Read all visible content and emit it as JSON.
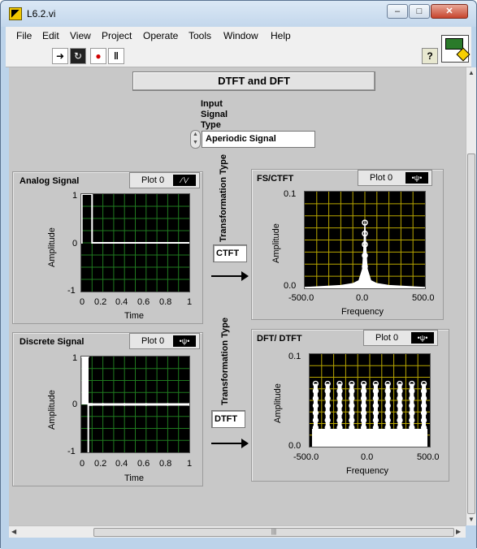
{
  "window": {
    "title": "L6.2.vi",
    "controls": {
      "minimize": "–",
      "maximize": "□",
      "close": "✕"
    }
  },
  "menu": [
    "File",
    "Edit",
    "View",
    "Project",
    "Operate",
    "Tools",
    "Window",
    "Help"
  ],
  "toolbar": {
    "icons": [
      "run-arrow-icon",
      "run-continuously-icon",
      "abort-icon",
      "pause-icon"
    ],
    "run": "➜",
    "run_continuous": "↻",
    "abort": "●",
    "pause": "‖",
    "help": "?"
  },
  "panel": {
    "title": "DTFT and DFT",
    "selector": {
      "label": "Input Signal Type",
      "value": "Aperiodic Signal"
    },
    "legend_label": "Plot 0",
    "transformation_label": "Transformation Type",
    "analog": {
      "title": "Analog Signal",
      "ylabel": "Amplitude",
      "xlabel": "Time",
      "yticks": [
        "1",
        "0",
        "-1"
      ],
      "xticks": [
        "0",
        "0.2",
        "0.4",
        "0.6",
        "0.8",
        "1"
      ]
    },
    "discrete": {
      "title": "Discrete Signal",
      "ylabel": "Amplitude",
      "xlabel": "Time",
      "yticks": [
        "1",
        "0",
        "-1"
      ],
      "xticks": [
        "0",
        "0.2",
        "0.4",
        "0.6",
        "0.8",
        "1"
      ]
    },
    "fs_ctft": {
      "title": "FS/CTFT",
      "ylabel": "Amplitude",
      "xlabel": "Frequency",
      "yticks": [
        "0.1",
        "0.0"
      ],
      "xticks": [
        "-500.0",
        "0.0",
        "500.0"
      ],
      "transform": "CTFT"
    },
    "dft": {
      "title": "DFT/ DTFT",
      "ylabel": "Amplitude",
      "xlabel": "Frequency",
      "yticks": [
        "0.1",
        "0.0"
      ],
      "xticks": [
        "-500.0",
        "0.0",
        "500.0"
      ],
      "transform": "DTFT"
    }
  },
  "colors": {
    "plot_bg": "#000000",
    "grid": "#1f7a1f",
    "grid_fft": "#b8a600",
    "trace": "#ffffff",
    "panel": "#c8c8c8"
  },
  "chart_data": [
    {
      "type": "line",
      "title": "Analog Signal",
      "xlabel": "Time",
      "ylabel": "Amplitude",
      "xlim": [
        0,
        1
      ],
      "ylim": [
        -1,
        1
      ],
      "series": [
        {
          "x": [
            0,
            0.005,
            0.005,
            0.1,
            0.1,
            1
          ],
          "y": [
            0,
            0,
            1,
            1,
            0,
            0
          ]
        }
      ]
    },
    {
      "type": "scatter",
      "title": "Discrete Signal",
      "xlabel": "Time",
      "ylabel": "Amplitude",
      "xlim": [
        0,
        1
      ],
      "ylim": [
        -1,
        1
      ],
      "series": [
        {
          "x": [
            0.01,
            0.02,
            0.03,
            0.04,
            0.05,
            0.06,
            0.07,
            0.08,
            0.09,
            0.1,
            0.2,
            0.4,
            0.6,
            0.8,
            1.0
          ],
          "y": [
            1,
            1,
            1,
            1,
            1,
            1,
            0,
            0,
            0,
            0,
            0,
            0,
            0,
            0,
            0
          ]
        }
      ]
    },
    {
      "type": "line",
      "title": "FS/CTFT",
      "xlabel": "Frequency",
      "ylabel": "Amplitude",
      "xlim": [
        -500,
        500
      ],
      "ylim": [
        0,
        0.1
      ],
      "series": [
        {
          "x": [
            -500,
            -200,
            -100,
            -50,
            -20,
            -10,
            0,
            10,
            20,
            50,
            100,
            200,
            500
          ],
          "y": [
            0.001,
            0.003,
            0.005,
            0.008,
            0.02,
            0.04,
            0.07,
            0.04,
            0.02,
            0.008,
            0.005,
            0.003,
            0.001
          ]
        }
      ]
    },
    {
      "type": "line",
      "title": "DFT/ DTFT",
      "xlabel": "Frequency",
      "ylabel": "Amplitude",
      "xlim": [
        -500,
        500
      ],
      "ylim": [
        0,
        0.1
      ],
      "series": [
        {
          "x": [
            -450,
            -350,
            -250,
            -150,
            -50,
            50,
            150,
            250,
            350,
            450
          ],
          "y": [
            0.068,
            0.068,
            0.068,
            0.068,
            0.068,
            0.068,
            0.068,
            0.068,
            0.068,
            0.068
          ]
        }
      ]
    }
  ]
}
